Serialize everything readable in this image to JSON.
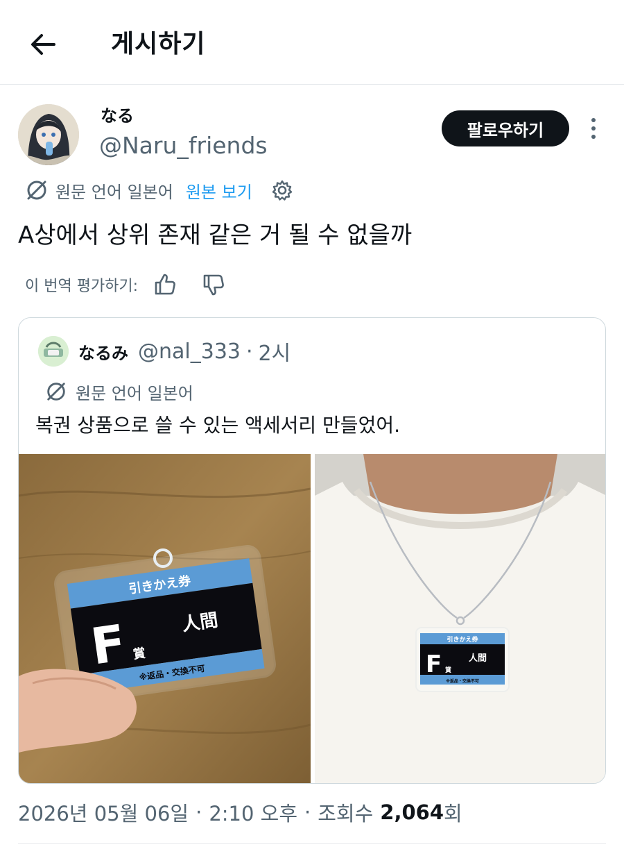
{
  "header": {
    "title": "게시하기"
  },
  "post": {
    "author_name": "なる",
    "author_handle": "@Naru_friends",
    "follow_label": "팔로우하기",
    "translation_label": "원문 언어 일본어",
    "show_original_label": "원본 보기",
    "text": "A상에서 상위 존재 같은 거 될 수 없을까",
    "rate_label": "이 번역 평가하기:"
  },
  "quote": {
    "author_name": "なるみ",
    "author_handle": "@nal_333",
    "dot": "·",
    "time": "2시",
    "translation_label": "원문 언어 일본어",
    "text": "복권 상품으로 쓸 수 있는 액세서리 만들었어.",
    "ticket": {
      "header": "引きかえ券",
      "grade": "F",
      "grade_suffix": "賞",
      "name": "人間",
      "footer": "※返品・交換不可"
    }
  },
  "meta": {
    "date": "2026년 05월 06일",
    "sep1": "·",
    "time": "2:10 오후",
    "sep2": "·",
    "views_label": "조회수",
    "views_count": "2,064",
    "views_suffix": "회"
  },
  "colors": {
    "text_primary": "#0f1419",
    "text_secondary": "#536471",
    "accent": "#1d9bf0",
    "border": "#cfd9de"
  },
  "icons": {
    "back": "arrow-left-icon",
    "more": "more-vertical-icon",
    "translate": "translate-off-icon",
    "settings": "gear-icon",
    "thumbs_up": "thumbs-up-icon",
    "thumbs_down": "thumbs-down-icon"
  }
}
